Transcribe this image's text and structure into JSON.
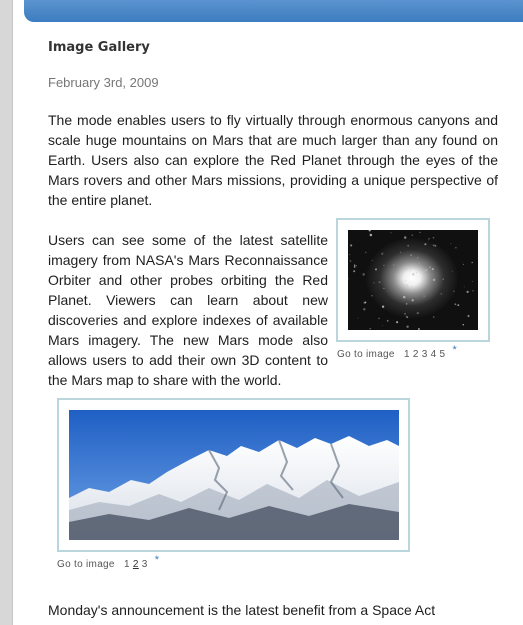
{
  "article": {
    "title": "Image Gallery",
    "date": "February 3rd, 2009",
    "paragraph1": "The mode enables users to fly virtually through enormous canyons and scale huge mountains on Mars that are much larger than any found on Earth. Users also can explore the Red Planet through the eyes of the Mars rovers and other Mars missions, providing a unique perspective of the entire planet.",
    "paragraph2": "Users can see some of the latest satellite imagery from NASA's Mars Reconnaissance Orbiter and other probes orbiting the Red Planet. Viewers can learn about new discoveries and explore indexes of available Mars imagery. The new Mars mode also allows users to add their own 3D content to the Mars map to share with the world.",
    "paragraph3": "Monday's announcement is the latest benefit from a Space Act"
  },
  "gallery1": {
    "nav_label": "Go to image",
    "pages": [
      "1",
      "2",
      "3",
      "4",
      "5"
    ],
    "star": "*"
  },
  "gallery2": {
    "nav_label": "Go to image",
    "pages": [
      "1",
      "2",
      "3"
    ],
    "active_page": "2",
    "star": "*"
  },
  "colors": {
    "accent": "#3c7cc0",
    "frame_border": "#b9d6dc"
  }
}
